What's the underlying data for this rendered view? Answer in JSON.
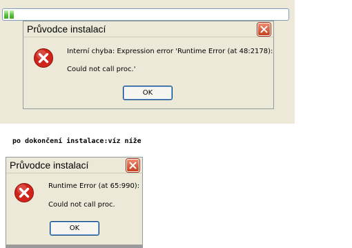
{
  "progress": {
    "fraction": 0.03
  },
  "dialog_top": {
    "title": "Průvodce instalací",
    "message_line1": "Interní chyba: Expression error 'Runtime Error (at 48:2178):",
    "message_line2": "Could not call proc.'",
    "ok_label": "OK",
    "icon": "error-icon"
  },
  "caption": "po dokončení instalace:víz níže",
  "dialog_bottom": {
    "title": "Průvodce instalací",
    "message_line1": "Runtime Error (at 65:990):",
    "message_line2": "Could not call proc.",
    "ok_label": "OK",
    "icon": "error-icon"
  },
  "colors": {
    "dialog_bg": "#ece9d8",
    "close_red": "#c4401d",
    "error_red": "#d0241b",
    "progress_green": "#5bc13e"
  }
}
